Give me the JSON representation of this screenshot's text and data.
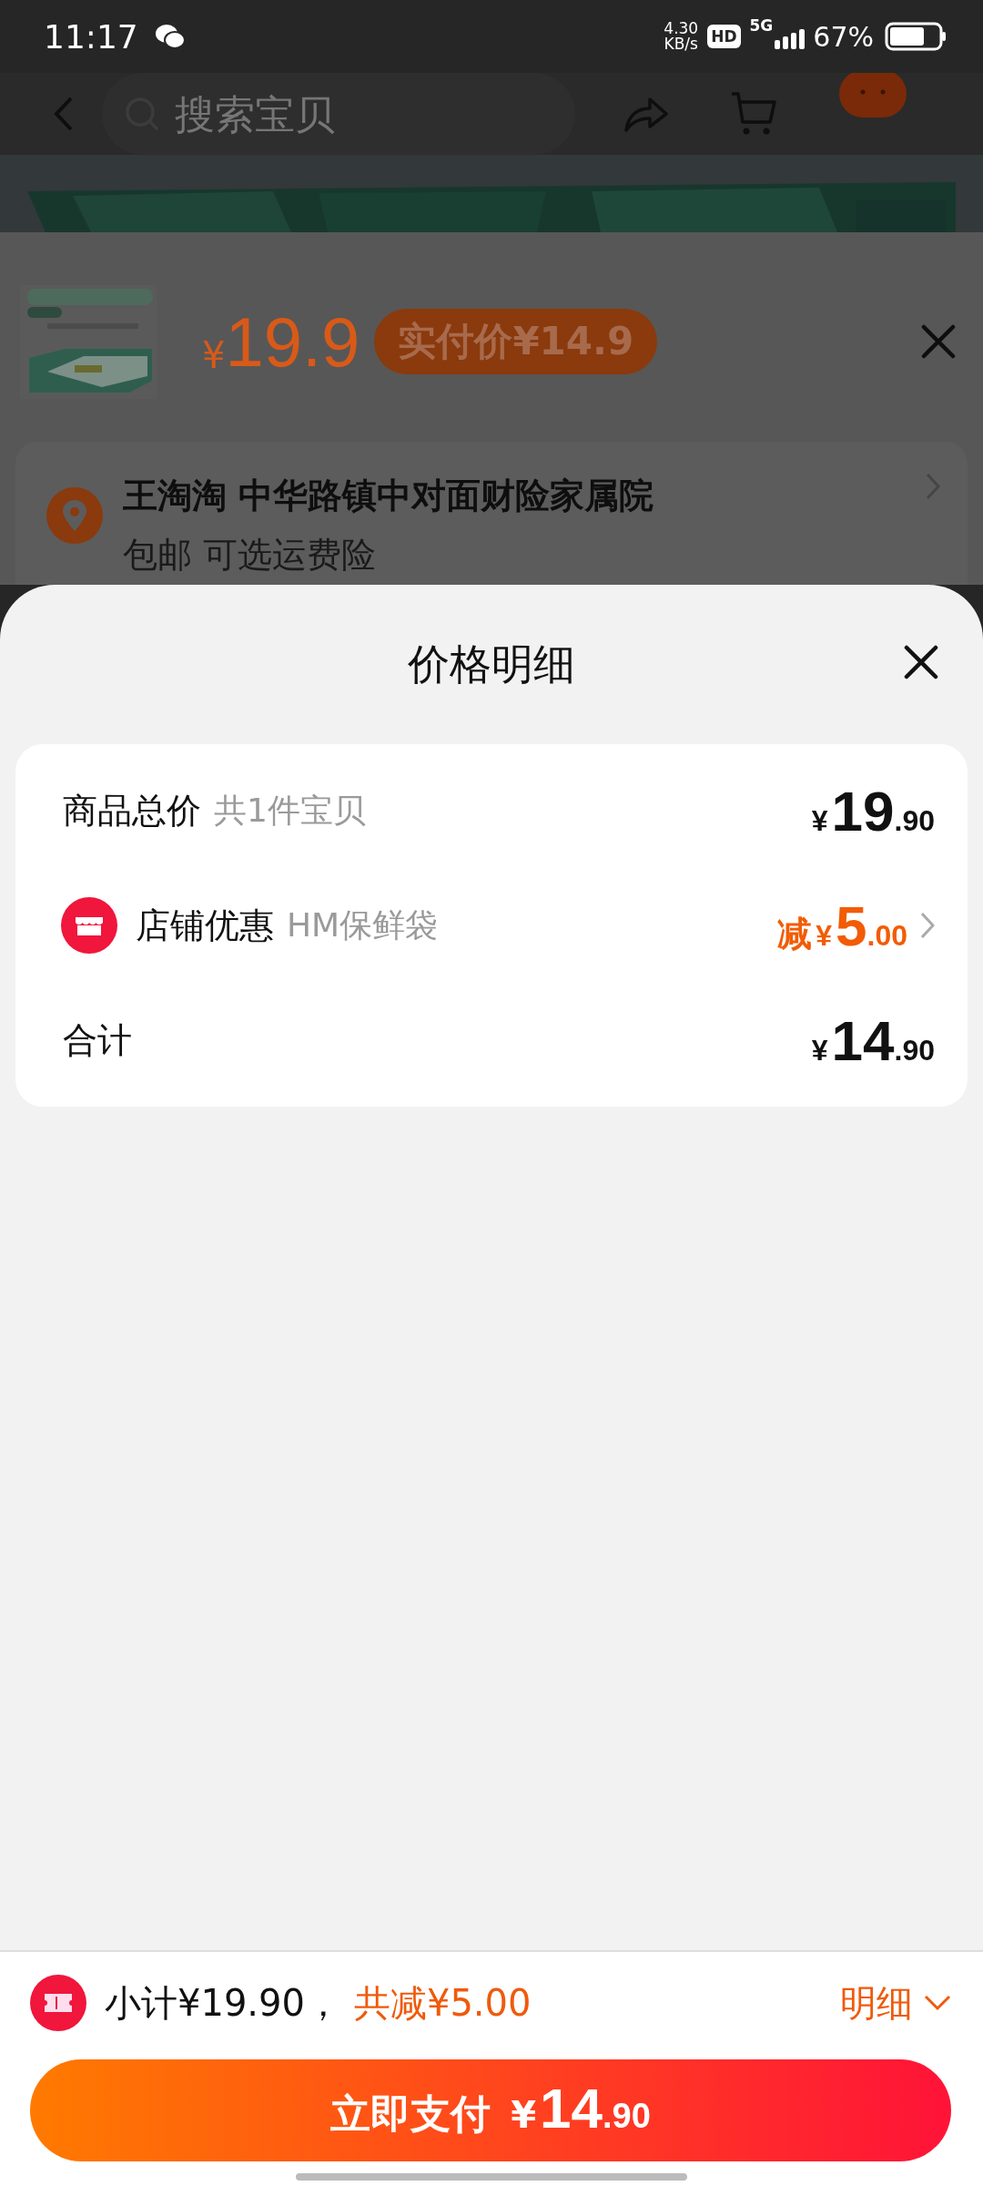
{
  "status_bar": {
    "time": "11:17",
    "net_speed": "4.30",
    "net_unit": "KB/s",
    "hd": "HD",
    "network": "5G",
    "battery": "67%"
  },
  "header": {
    "search": {
      "placeholder": "搜索宝贝"
    }
  },
  "product": {
    "currency": "¥",
    "price": "19.9",
    "pay_badge": "实付价¥14.9"
  },
  "address": {
    "name_line": "王淘淘 中华路镇中对面财险家属院",
    "subline": "包邮 可选运费险"
  },
  "sheet": {
    "title": "价格明细",
    "rows": [
      {
        "kind": "total",
        "label": "商品总价",
        "note": "共1件宝贝",
        "currency": "¥",
        "integer": "19",
        "decimal": ".90"
      },
      {
        "kind": "discount",
        "label": "店铺优惠",
        "note": "HM保鲜袋",
        "prefix": "减",
        "currency": "¥",
        "integer": "5",
        "decimal": ".00"
      },
      {
        "kind": "sum",
        "label": "合计",
        "currency": "¥",
        "integer": "14",
        "decimal": ".90"
      }
    ]
  },
  "footer": {
    "subtotal": "小计¥19.90，",
    "discount": "共减¥5.00",
    "details": "明细",
    "pay_button": {
      "label": "立即支付",
      "currency": "¥",
      "integer": "14",
      "decimal": ".90"
    }
  }
}
